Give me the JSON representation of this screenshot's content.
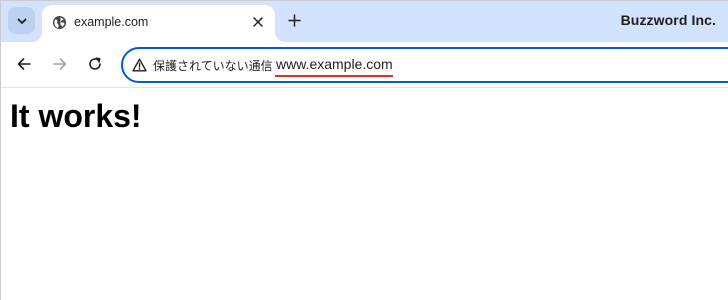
{
  "browser": {
    "tab": {
      "title": "example.com",
      "favicon": "globe-icon"
    },
    "profile_name": "Buzzword Inc.",
    "toolbar": {
      "security_label": "保護されていない通信",
      "url": "www.example.com"
    }
  },
  "page": {
    "heading": "It works!"
  },
  "colors": {
    "tabstrip": "#d3e3fd",
    "omnibox_border": "#0b57d0",
    "url_underline": "#d93025"
  }
}
